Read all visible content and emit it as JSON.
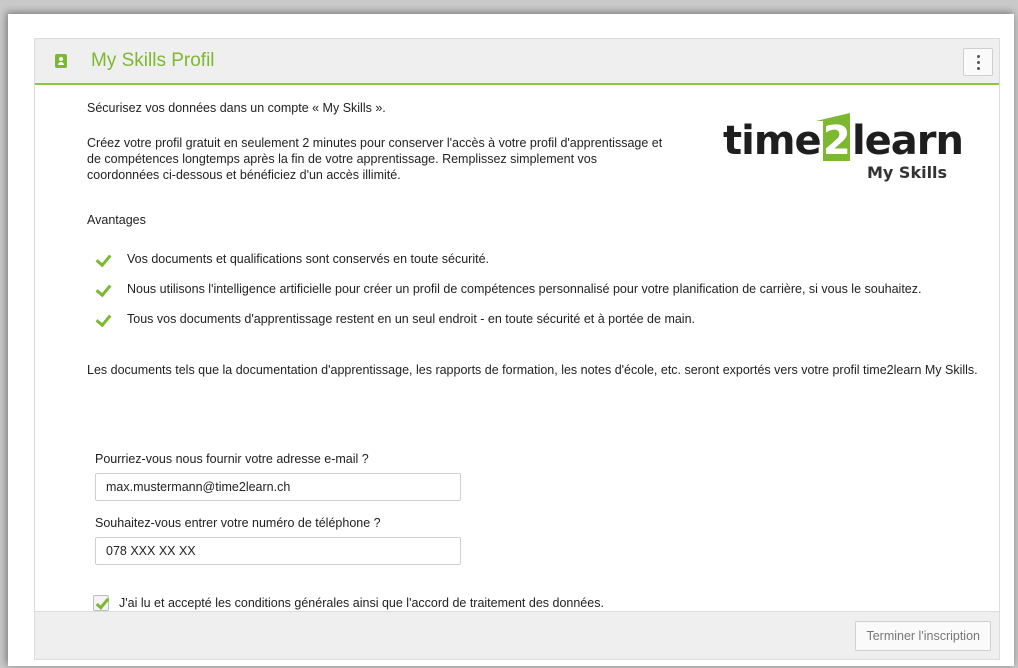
{
  "panel": {
    "title": "My Skills Profil"
  },
  "intro": {
    "heading": "Sécurisez vos données dans un compte « My Skills ».",
    "paragraph": "Créez votre profil gratuit en seulement 2 minutes pour conserver l'accès à votre profil d'apprentissage et de compétences longtemps après la fin de votre apprentissage. Remplissez simplement vos coordonnées ci-dessous et bénéficiez d'un accès illimité."
  },
  "logo": {
    "word_left": "time",
    "word_box": "2",
    "word_right": "learn",
    "subtitle": "My Skills"
  },
  "advantages": {
    "title": "Avantages",
    "items": [
      "Vos documents et qualifications sont conservés en toute sécurité.",
      "Nous utilisons l'intelligence artificielle pour créer un profil de compétences personnalisé pour votre planification de carrière, si vous le souhaitez.",
      "Tous vos documents d'apprentissage restent en un seul endroit - en toute sécurité et à portée de main."
    ]
  },
  "docs_note": "Les documents tels que la documentation d'apprentissage, les rapports de formation, les notes d'école, etc. seront exportés vers votre profil time2learn My Skills.",
  "form": {
    "email_label": "Pourriez-vous nous fournir votre adresse e-mail ?",
    "email_value": "max.mustermann@time2learn.ch",
    "phone_label": "Souhaitez-vous entrer votre numéro de téléphone ?",
    "phone_value": "078 XXX XX XX",
    "terms_label": "J'ai lu et accepté les conditions générales ainsi que l'accord de traitement des données.",
    "terms_checked": true
  },
  "footer": {
    "submit_label": "Terminer l'inscription"
  },
  "colors": {
    "accent": "#7db832",
    "header_bg": "#efefef"
  }
}
